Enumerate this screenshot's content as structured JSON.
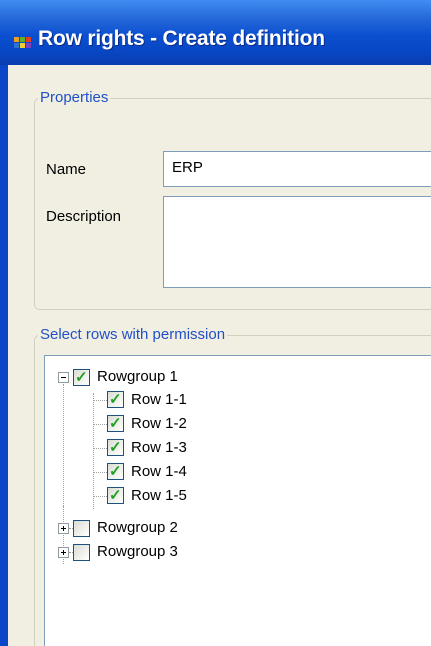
{
  "window": {
    "title": "Row rights - Create definition"
  },
  "properties_group": {
    "legend": "Properties",
    "name_label": "Name",
    "name_value": "ERP",
    "description_label": "Description",
    "description_value": ""
  },
  "rows_group": {
    "legend": "Select rows with permission"
  },
  "tree": {
    "groups": [
      {
        "label": "Rowgroup 1",
        "expanded": true,
        "checked": true,
        "rows": [
          {
            "label": "Row 1-1",
            "checked": true
          },
          {
            "label": "Row 1-2",
            "checked": true
          },
          {
            "label": "Row 1-3",
            "checked": true
          },
          {
            "label": "Row 1-4",
            "checked": true
          },
          {
            "label": "Row 1-5",
            "checked": true
          }
        ]
      },
      {
        "label": "Rowgroup 2",
        "expanded": false,
        "checked": false
      },
      {
        "label": "Rowgroup 3",
        "expanded": false,
        "checked": false
      }
    ]
  },
  "icons": {
    "title_icon": "app-grid-icon",
    "expander_collapse": "minus-box-icon",
    "expander_expand": "plus-box-icon",
    "checkbox_checked": "checkmark-icon"
  },
  "colors": {
    "titlebar": "#0a4fd0",
    "legend_text": "#2150c8",
    "window_bg": "#f1efe2",
    "check": "#21a121",
    "input_border": "#7f9db9"
  }
}
